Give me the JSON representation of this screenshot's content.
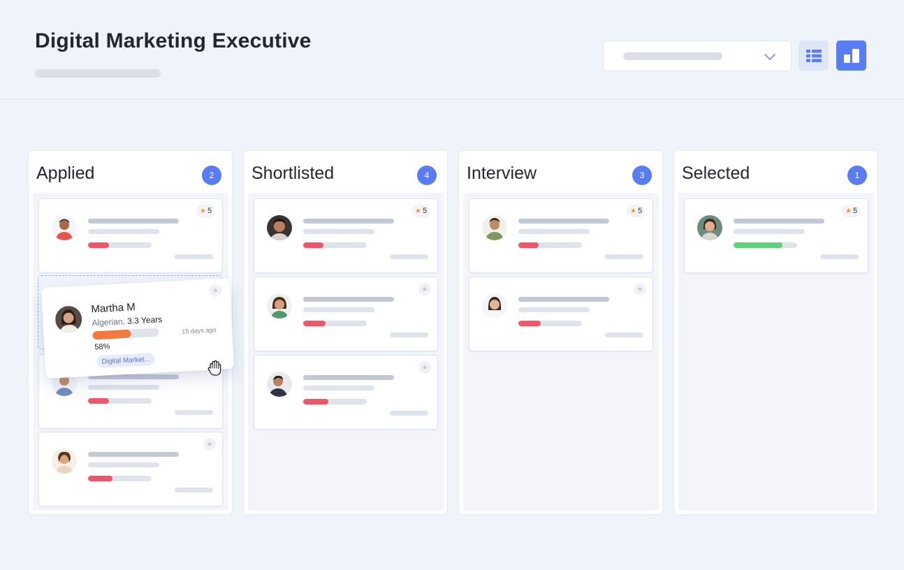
{
  "header": {
    "title": "Digital Marketing Executive"
  },
  "toolbar": {
    "filter_icon": "chevron-down-icon",
    "grid_view_icon": "grid-icon",
    "board_view_icon": "kanban-icon",
    "accent_color": "#5a7cf2"
  },
  "columns": [
    {
      "title": "Applied",
      "count": "2"
    },
    {
      "title": "Shortlisted",
      "count": "4"
    },
    {
      "title": "Interview",
      "count": "3"
    },
    {
      "title": "Selected",
      "count": "1"
    }
  ],
  "cards": {
    "applied_1": {
      "rating": "5",
      "progress": 0.33
    },
    "applied_2": {
      "progress": 0.33
    },
    "applied_3": {
      "progress": 0.38
    },
    "shortlisted_1": {
      "rating": "5",
      "progress": 0.32
    },
    "shortlisted_2": {
      "progress": 0.35
    },
    "shortlisted_3": {
      "progress": 0.4
    },
    "interview_1": {
      "rating": "5",
      "progress": 0.32
    },
    "interview_2": {
      "progress": 0.35
    },
    "selected_1": {
      "rating": "5",
      "progress": 0.77
    }
  },
  "dragged_card": {
    "name": "Martha M",
    "nationality": "Algerian,",
    "experience": "3.3 Years",
    "progress_label": "58%",
    "progress": 0.58,
    "time_ago": "15 days ago",
    "tag": "Digital Market..."
  }
}
